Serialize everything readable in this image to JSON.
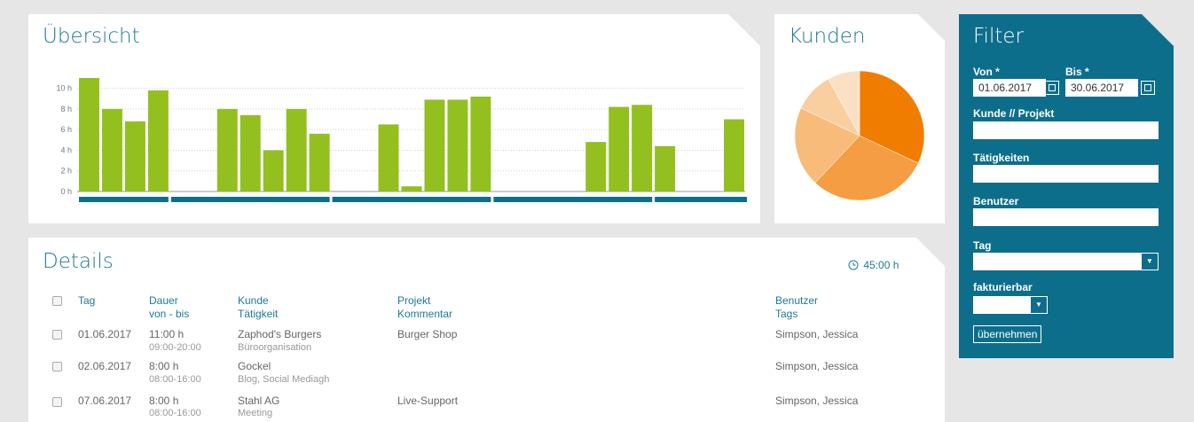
{
  "overview": {
    "title": "Übersicht",
    "y_ticks": [
      "10 h",
      "8 h",
      "6 h",
      "4 h",
      "2 h",
      "0 h"
    ]
  },
  "chart_data": {
    "type": "bar",
    "ylim": [
      0,
      11
    ],
    "ylabel": "",
    "xlabel": "",
    "unit": "h",
    "color": "#93c01f",
    "week_bar_color": "#0d6e8c",
    "values": [
      11.0,
      8.0,
      6.8,
      9.8,
      0,
      0,
      8.0,
      7.4,
      4.0,
      8.0,
      5.6,
      0,
      0,
      6.5,
      0.5,
      8.9,
      8.9,
      9.2,
      0,
      0,
      0,
      0,
      4.8,
      8.2,
      8.4,
      4.4,
      0,
      0,
      7.0
    ],
    "week_groups": [
      4,
      7,
      7,
      7,
      5
    ]
  },
  "kunden": {
    "title": "Kunden",
    "chart_data": {
      "type": "pie",
      "values": [
        32,
        30,
        20,
        10,
        8
      ],
      "colors": [
        "#f07d00",
        "#f59d42",
        "#f8bb7a",
        "#f9cfa0",
        "#fbe0c4"
      ]
    }
  },
  "details": {
    "title": "Details",
    "total": "45:00 h",
    "columns": {
      "tag": "Tag",
      "dauer": "Dauer",
      "dauer_sub": "von - bis",
      "kunde": "Kunde",
      "kunde_sub": "Tätigkeit",
      "projekt": "Projekt",
      "projekt_sub": "Kommentar",
      "benutzer": "Benutzer",
      "benutzer_sub": "Tags"
    },
    "rows": [
      {
        "date": "01.06.2017",
        "duration": "11:00 h",
        "range": "09:00-20:00",
        "customer": "Zaphod's Burgers",
        "activity": "Büroorganisation",
        "project": "Burger Shop",
        "user": "Simpson, Jessica"
      },
      {
        "date": "02.06.2017",
        "duration": "8:00 h",
        "range": "08:00-16:00",
        "customer": "Gockel",
        "activity": "Blog, Social Mediagh",
        "project": "",
        "user": "Simpson, Jessica"
      },
      {
        "date": "07.06.2017",
        "duration": "8:00 h",
        "range": "08:00-16:00",
        "customer": "Stahl AG",
        "activity": "Meeting",
        "project": "Live-Support",
        "user": "Simpson, Jessica"
      }
    ]
  },
  "filter": {
    "title": "Filter",
    "von_label": "Von *",
    "von_value": "01.06.2017",
    "bis_label": "Bis *",
    "bis_value": "30.06.2017",
    "kunde_label": "Kunde // Projekt",
    "taetigkeiten_label": "Tätigkeiten",
    "benutzer_label": "Benutzer",
    "tag_label": "Tag",
    "fakturierbar_label": "fakturierbar",
    "apply_label": "übernehmen"
  }
}
